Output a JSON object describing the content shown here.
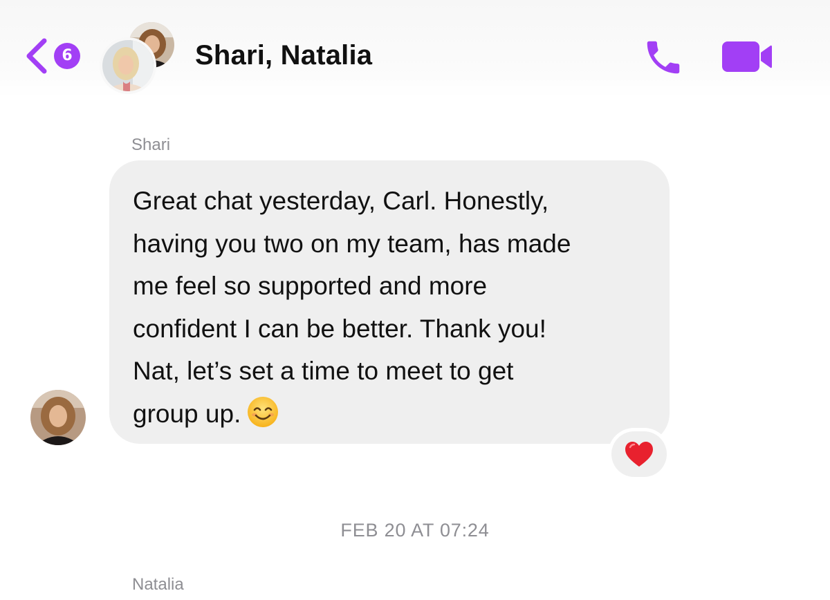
{
  "header": {
    "unread_count": "6",
    "title": "Shari, Natalia",
    "back_icon": "chevron-left-icon",
    "call_icon": "phone-icon",
    "video_icon": "video-camera-icon",
    "accent_color": "#a23ff5"
  },
  "messages": [
    {
      "sender": "Shari",
      "lines": [
        "Great chat yesterday, Carl. Honestly,",
        "having you two on my team, has made",
        "me feel so supported and more",
        "confident I can be better. Thank you!",
        "Nat, let’s set a time to meet to get",
        "group up."
      ],
      "emoji": "smiling-face-emoji",
      "reaction": "red-heart-emoji"
    }
  ],
  "timestamp": "FEB 20 AT 07:24",
  "next_sender": "Natalia"
}
